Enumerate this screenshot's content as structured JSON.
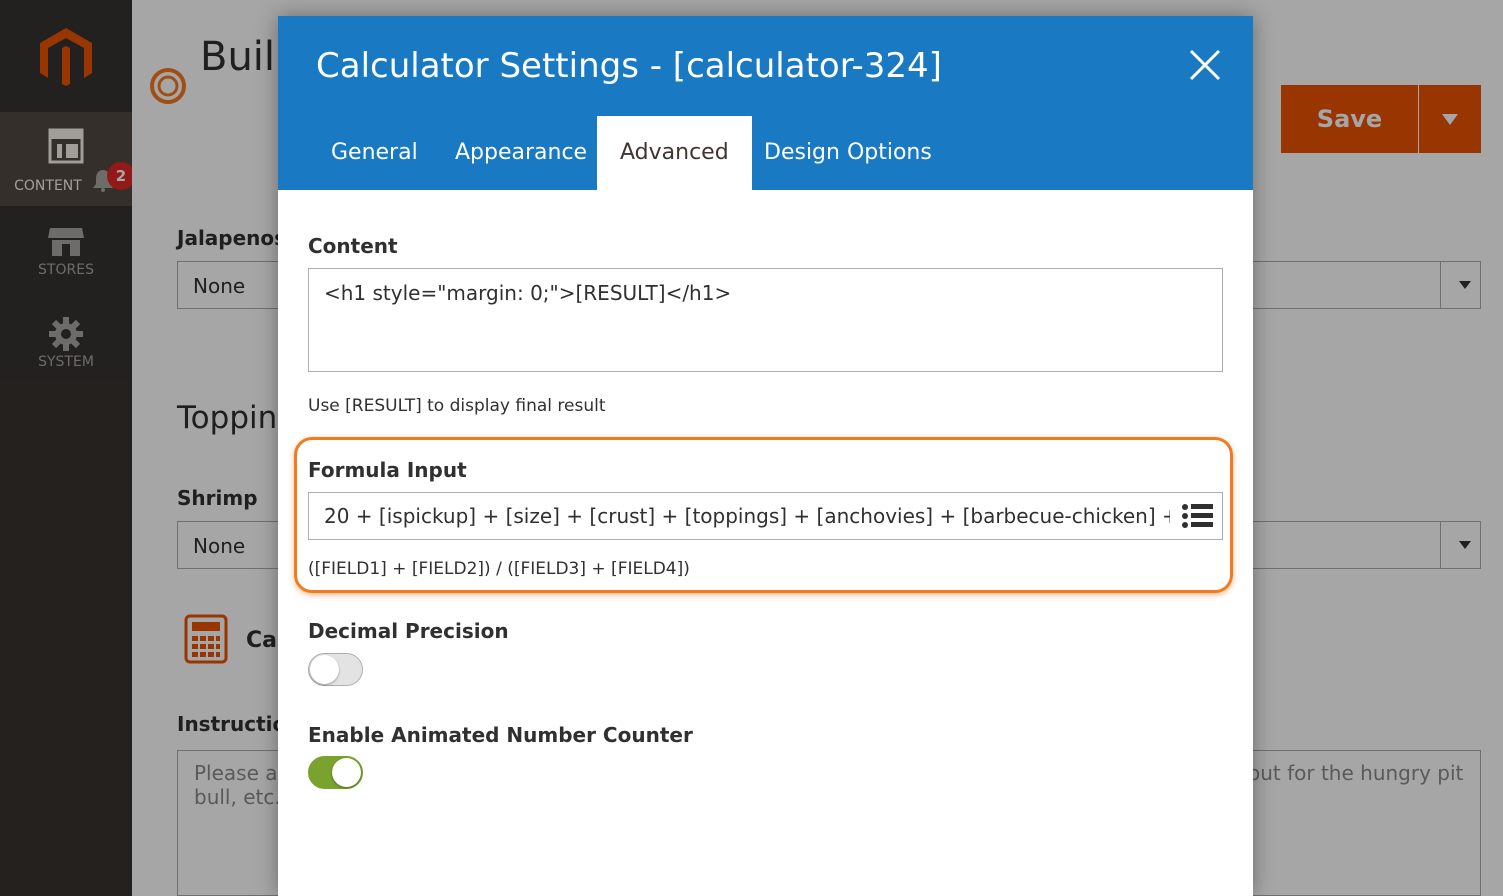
{
  "sidebar": {
    "items": [
      {
        "label": "CONTENT",
        "icon": "layout-icon",
        "badge": "2"
      },
      {
        "label": "STORES",
        "icon": "store-icon"
      },
      {
        "label": "SYSTEM",
        "icon": "gear-icon"
      }
    ]
  },
  "page": {
    "title": "Buil",
    "save_label": "Save",
    "jalapenos_label": "Jalapenos",
    "jalapenos_value": "None",
    "toppings_heading": "Topping",
    "shrimp_label": "Shrimp",
    "shrimp_value": "None",
    "calc_label": "Cal",
    "instructions_label": "Instruction",
    "instructions_placeholder_left": "Please ac bull, etc.",
    "instructions_placeholder_right": "out for the hungry pit"
  },
  "modal": {
    "title": "Calculator Settings - [calculator-324]",
    "tabs": [
      {
        "label": "General"
      },
      {
        "label": "Appearance"
      },
      {
        "label": "Advanced"
      },
      {
        "label": "Design Options"
      }
    ],
    "active_tab": "Advanced",
    "content_label": "Content",
    "content_value": "<h1 style=\"margin: 0;\">[RESULT]</h1>",
    "content_note": "Use [RESULT] to display final result",
    "formula_label": "Formula Input",
    "formula_value": "20 + [ispickup] + [size] + [crust] + [toppings] + [anchovies] + [barbecue-chicken] + [jalapenos]",
    "formula_note": "([FIELD1] + [FIELD2]) / ([FIELD3] + [FIELD4])",
    "decimal_label": "Decimal Precision",
    "decimal_enabled": false,
    "animated_label": "Enable Animated Number Counter",
    "animated_enabled": true
  },
  "colors": {
    "header": "#1979c3",
    "save": "#eb5202",
    "highlight": "#f47a20",
    "toggle_on": "#79a22e"
  }
}
